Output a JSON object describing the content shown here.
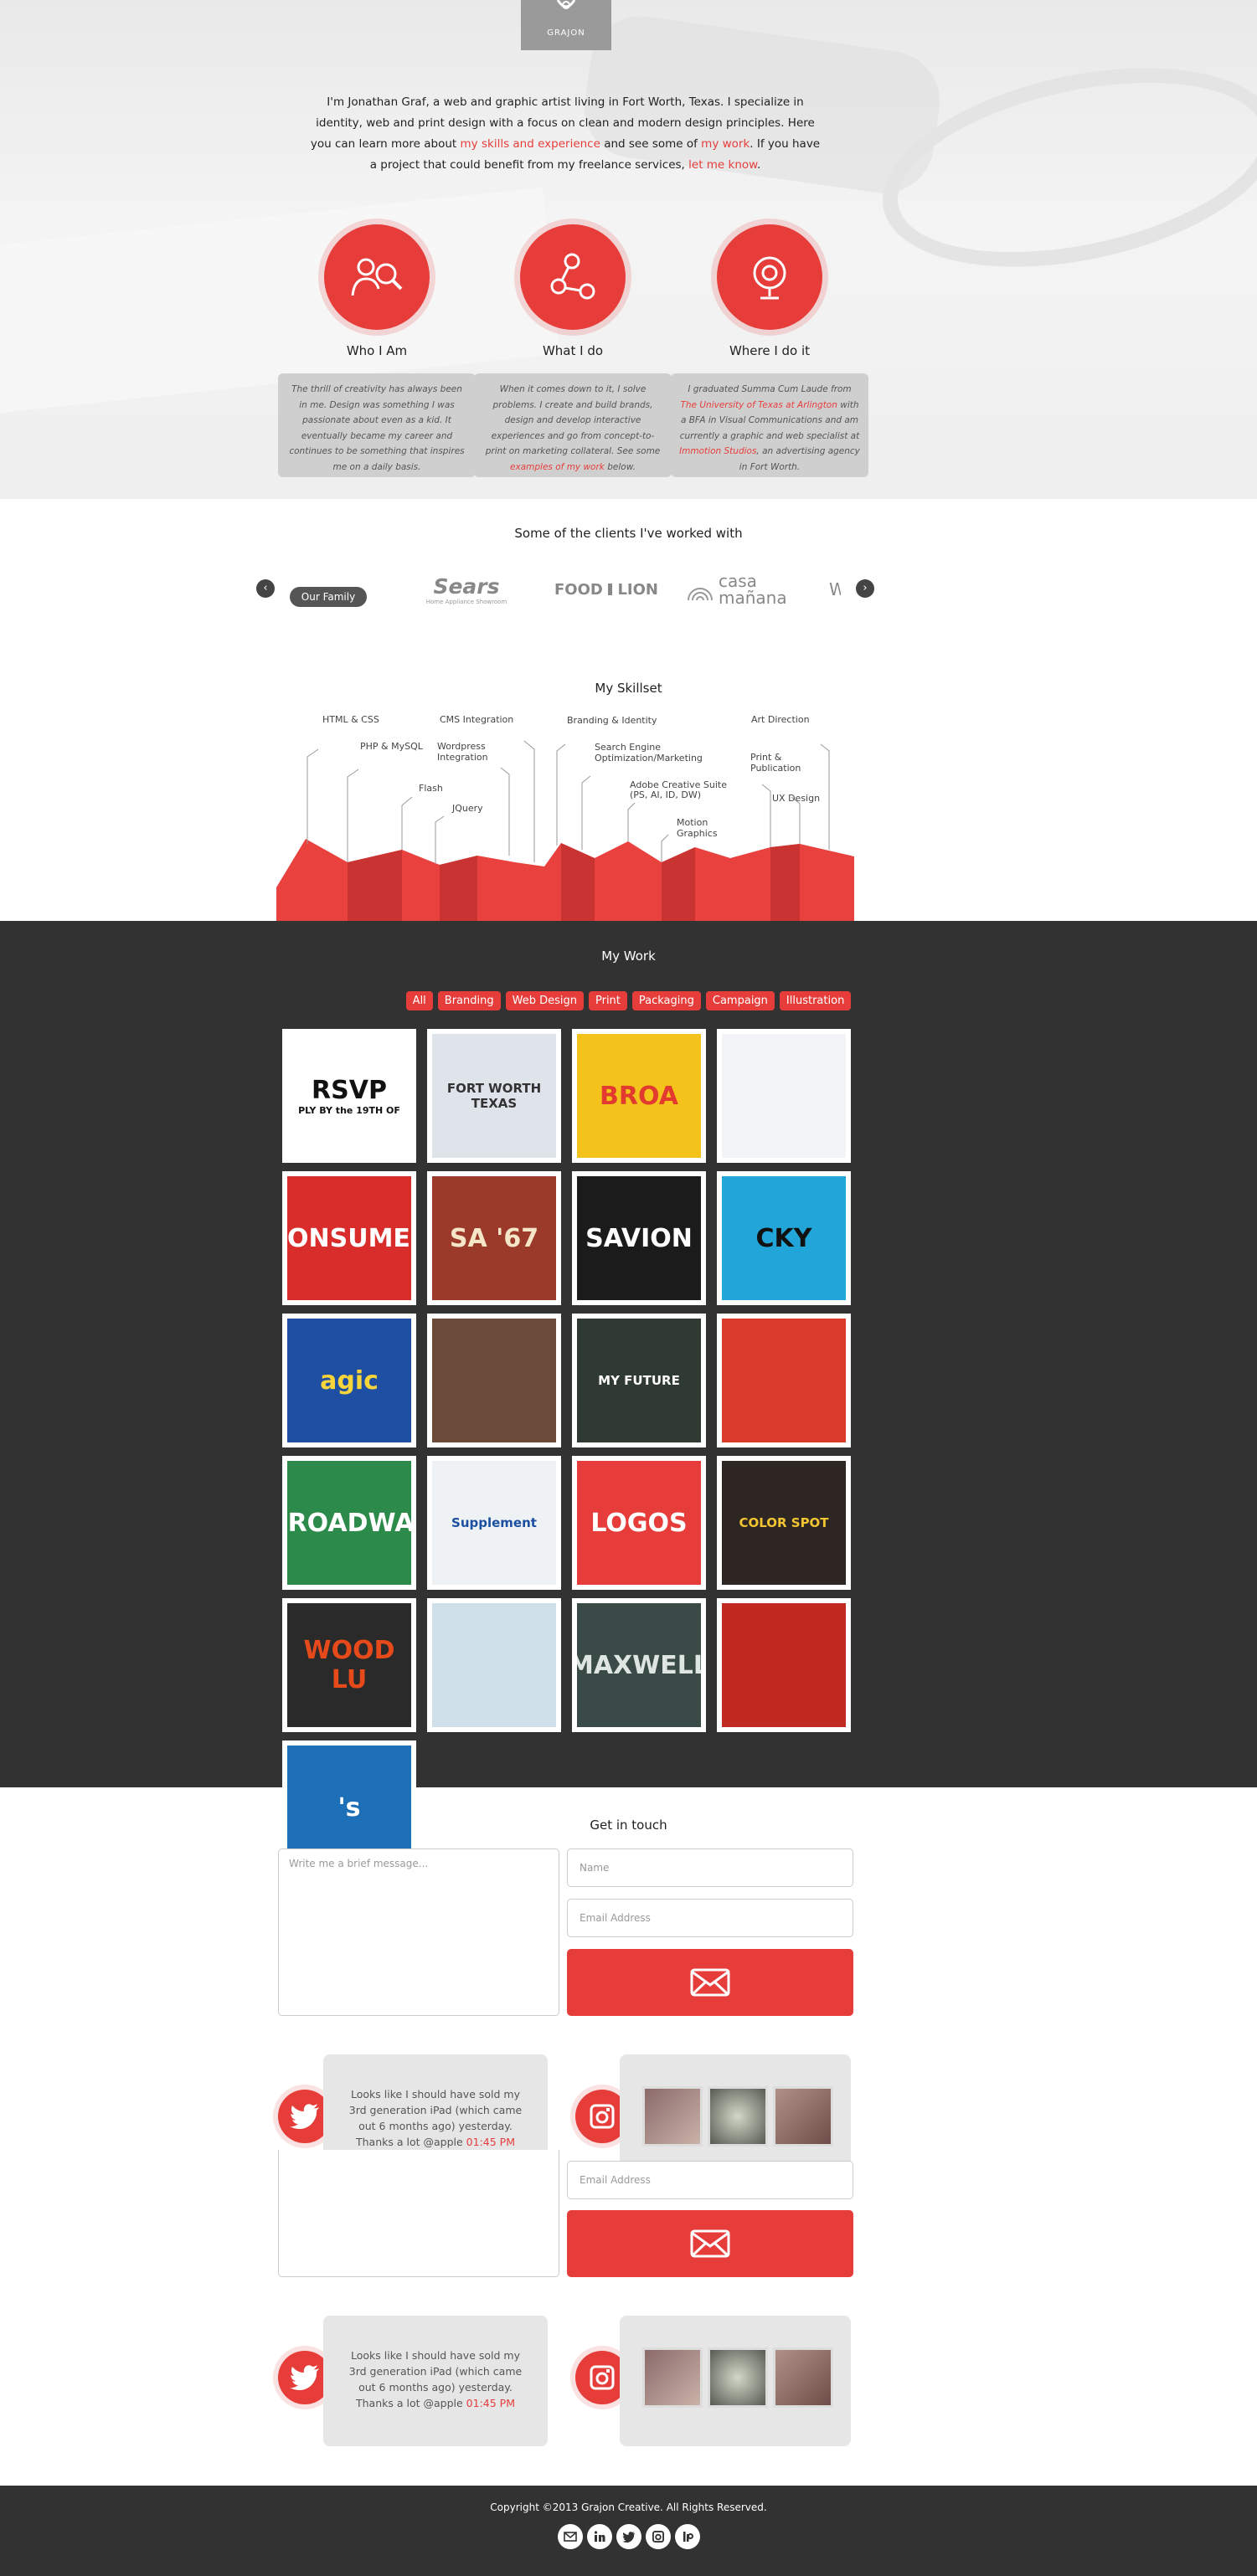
{
  "brand": {
    "logo_text": "GRAJON"
  },
  "intro": {
    "p1": "I'm Jonathan Graf, a web and graphic artist living in Fort Worth, Texas. I specialize in identity, web and print design with a focus on clean and modern design principles. Here you can learn more about ",
    "link1": "my skills and experience",
    "p2": " and see some of ",
    "link2": "my work",
    "p3": ". If you have a project that could benefit from my freelance services, ",
    "link3": "let me know",
    "p4": "."
  },
  "features": [
    {
      "icon": "search-person-icon",
      "title": "Who I Am",
      "text": "The thrill of creativity has always been in me. Design was something I was passionate about even as a kid. It eventually became my career and continues to be something that inspires me on a daily basis."
    },
    {
      "icon": "share-nodes-icon",
      "title": "What I do",
      "pre": "When it comes down to it, I solve problems. I create and build brands, design and develop interactive experiences and go from concept-to-print on marketing collateral. See some ",
      "link": "examples of my work",
      "post": " below."
    },
    {
      "icon": "location-pin-icon",
      "title": "Where I do it",
      "pre": "I graduated Summa Cum Laude from ",
      "link": "The University of Texas at Arlington",
      "mid": " with a BFA in Visual Communications and am currently a graphic and web specialist at ",
      "link2": "Immotion Studios",
      "post": ", an advertising agency in Fort Worth."
    }
  ],
  "clients": {
    "title": "Some of the clients I've worked with",
    "items": [
      "Our Family",
      "Sears",
      "Home Appliance Showroom",
      "FOOD",
      "LION",
      "casa",
      "mañana",
      "W"
    ],
    "prev": "‹",
    "next": "›"
  },
  "skills": {
    "title": "My Skillset",
    "labels": [
      "HTML & CSS",
      "PHP & MySQL",
      "Flash",
      "JQuery",
      "CMS Integration",
      "Wordpress Integration",
      "Branding & Identity",
      "Search Engine Optimization/Marketing",
      "Adobe Creative Suite (PS, AI, ID, DW)",
      "Motion Graphics",
      "Art Direction",
      "Print & Publication",
      "UX Design"
    ]
  },
  "work": {
    "title": "My Work",
    "filters": [
      "All",
      "Branding",
      "Web Design",
      "Print",
      "Packaging",
      "Campaign",
      "Illustration"
    ],
    "tiles": [
      {
        "text": "RSVP",
        "sub": "PLY BY the 19TH OF",
        "bg": "#ffffff",
        "fg": "#111"
      },
      {
        "text": "FORT WORTH TEXAS",
        "bg": "#dfe3ea",
        "fg": "#333"
      },
      {
        "text": "BROA",
        "bg": "#f3c21b",
        "fg": "#e23a2f"
      },
      {
        "text": "",
        "bg": "#f2f4f7",
        "fg": "#2a6fc9"
      },
      {
        "text": "CONSUMER",
        "bg": "#d82d2b",
        "fg": "#fff"
      },
      {
        "text": "SA '67",
        "bg": "#9b3a2a",
        "fg": "#f5e6c8"
      },
      {
        "text": "SAVION",
        "bg": "#1b1b1b",
        "fg": "#fff"
      },
      {
        "text": "CKY",
        "bg": "#22a6d9",
        "fg": "#111"
      },
      {
        "text": "agic",
        "bg": "#1e4fa3",
        "fg": "#f7d43a"
      },
      {
        "text": "",
        "bg": "#6b4a3a",
        "fg": "#fff"
      },
      {
        "text": "MY FUTURE",
        "bg": "#2f3a33",
        "fg": "#fff"
      },
      {
        "text": "",
        "bg": "#d93a2a",
        "fg": "#f3d44a"
      },
      {
        "text": "BROADWAY",
        "bg": "#2c8a4a",
        "fg": "#fff"
      },
      {
        "text": "Supplement",
        "bg": "#eef2f5",
        "fg": "#1c4fa0"
      },
      {
        "text": "LOGOS",
        "bg": "#e63d3b",
        "fg": "#fff"
      },
      {
        "text": "COLOR SPOT",
        "bg": "#2d2622",
        "fg": "#f4c533"
      },
      {
        "text": "WOOD LU",
        "bg": "#2a2a2a",
        "fg": "#e64a1a"
      },
      {
        "text": "",
        "bg": "#cfe0ea",
        "fg": "#333"
      },
      {
        "text": "MAXWELL",
        "bg": "#3a4a46",
        "fg": "#dfe6e2"
      },
      {
        "text": "",
        "bg": "#c12a20",
        "fg": "#fff"
      },
      {
        "text": "'s",
        "bg": "#1d6fb8",
        "fg": "#fff"
      }
    ]
  },
  "contact": {
    "title": "Get in touch",
    "message_placeholder": "Write me a brief message...",
    "name_placeholder": "Name",
    "email_placeholder": "Email Address"
  },
  "tweet": {
    "text": "Looks like I should have sold my 3rd generation iPad (which came out 6 months ago) yesterday. Thanks a lot @apple",
    "time": "01:45 PM"
  },
  "footer": {
    "copyright": "Copyright ©2013 Grajon Creative. All Rights Reserved."
  },
  "colors": {
    "accent": "#e63d3b",
    "dark": "#323232"
  }
}
